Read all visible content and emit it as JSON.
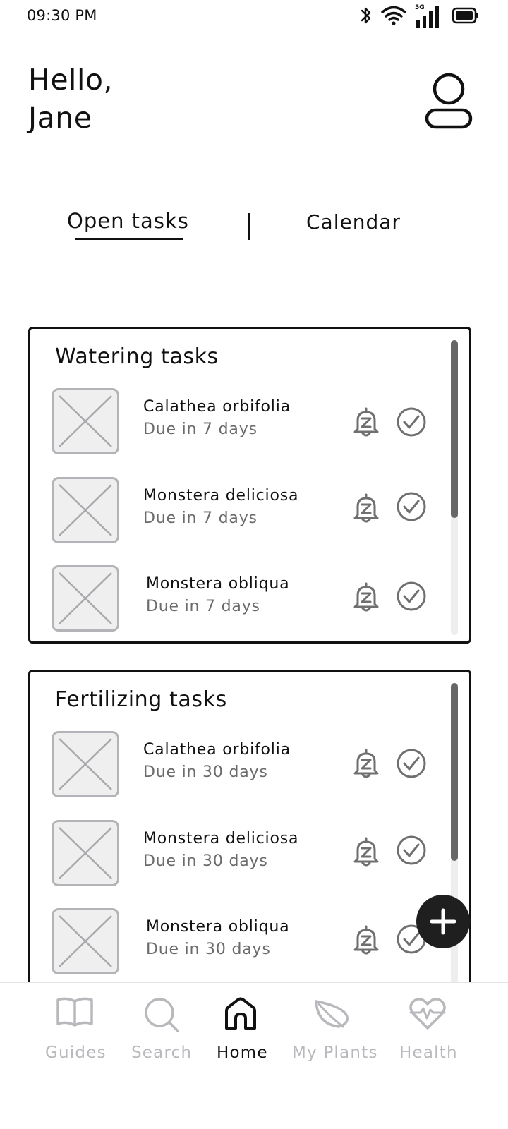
{
  "status_bar": {
    "time": "09:30 PM",
    "network_label": "5G"
  },
  "greeting": {
    "line1": "Hello,",
    "line2": "Jane"
  },
  "tabs": {
    "open_tasks": "Open tasks",
    "calendar": "Calendar",
    "active": "open_tasks"
  },
  "sections": [
    {
      "title": "Watering tasks",
      "tasks": [
        {
          "name": "Calathea orbifolia",
          "due": "Due in 7 days"
        },
        {
          "name": "Monstera deliciosa",
          "due": "Due in 7 days"
        },
        {
          "name": "Monstera obliqua",
          "due": "Due in 7 days"
        }
      ]
    },
    {
      "title": "Fertilizing tasks",
      "tasks": [
        {
          "name": "Calathea orbifolia",
          "due": "Due in 30 days"
        },
        {
          "name": "Monstera deliciosa",
          "due": "Due in 30 days"
        },
        {
          "name": "Monstera obliqua",
          "due": "Due in 30 days"
        }
      ]
    }
  ],
  "nav": {
    "items": [
      {
        "label": "Guides",
        "icon": "book-icon"
      },
      {
        "label": "Search",
        "icon": "search-icon"
      },
      {
        "label": "Home",
        "icon": "home-icon"
      },
      {
        "label": "My Plants",
        "icon": "leaf-icon"
      },
      {
        "label": "Health",
        "icon": "heart-pulse-icon"
      }
    ],
    "active": "Home"
  },
  "colors": {
    "ink": "#111111",
    "muted_text": "#6b6b6b",
    "icon_gray": "#6f6f6f",
    "nav_inactive": "#b9b9bd",
    "scroll_thumb": "#666666",
    "fab": "#1f1f1f"
  }
}
